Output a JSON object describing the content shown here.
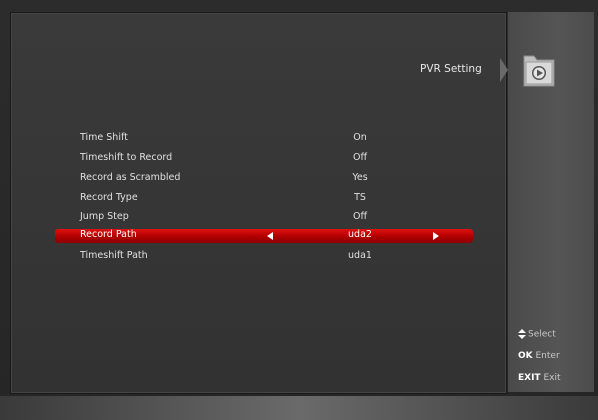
{
  "header": {
    "title": "PVR Setting",
    "folder_icon": "folder-play-icon"
  },
  "menu": {
    "items": [
      {
        "label": "Time Shift",
        "value": "On"
      },
      {
        "label": "Timeshift to Record",
        "value": "Off"
      },
      {
        "label": "Record as Scrambled",
        "value": "Yes"
      },
      {
        "label": "Record Type",
        "value": "TS"
      },
      {
        "label": "Jump Step",
        "value": "Off"
      },
      {
        "label": "Record Path",
        "value": "uda2"
      },
      {
        "label": "Timeshift Path",
        "value": "uda1"
      }
    ],
    "selected_index": 5
  },
  "hints": {
    "select": {
      "key_icon": "updown-icon",
      "text": "Select"
    },
    "ok": {
      "key": "OK",
      "text": "Enter"
    },
    "exit": {
      "key": "EXIT",
      "text": "Exit"
    }
  },
  "colors": {
    "selection": "#d00000",
    "background": "#333333"
  }
}
